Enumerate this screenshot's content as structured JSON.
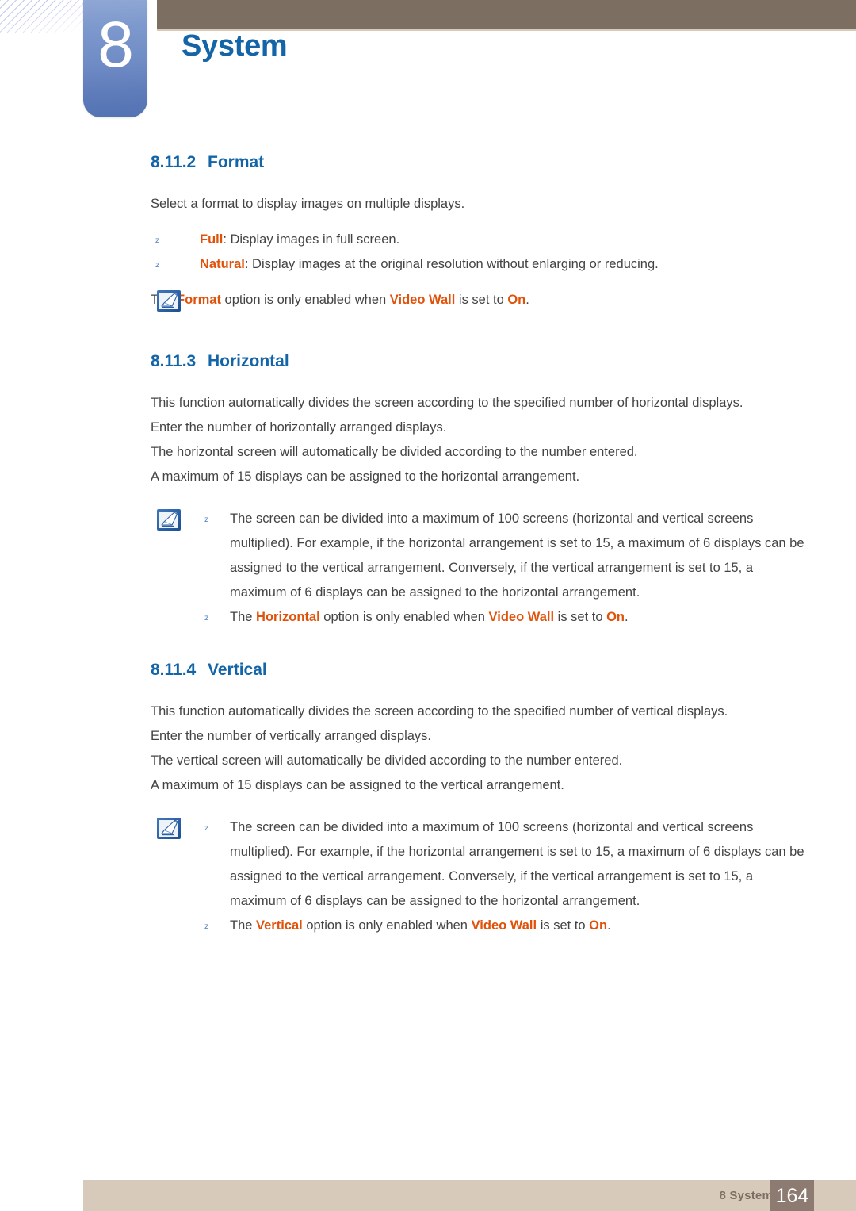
{
  "header": {
    "chapter_number": "8",
    "chapter_title": "System",
    "brand_blue": "#1365a8",
    "bar_brown": "#7d6e62",
    "badge_blue": "#6e8bc5"
  },
  "accent": {
    "highlight_orange": "#e0520a",
    "heading_blue": "#1365a8",
    "body_gray": "#434343"
  },
  "sections": [
    {
      "number": "8.11.2",
      "name": "Format",
      "intro": "Select a format to display images on multiple displays.",
      "bullets": [
        {
          "marker": "z",
          "term": "Full",
          "rest": ": Display images in full screen."
        },
        {
          "marker": "z",
          "term": "Natural",
          "rest": ": Display images at the original resolution without enlarging or reducing."
        }
      ],
      "note": {
        "icon": "note-quill-icon",
        "text_pre": "The ",
        "term1": "Format",
        "text_mid1": " option is only enabled when ",
        "term2": "Video Wall",
        "text_mid2": " is set to ",
        "term3": "On",
        "text_end": "."
      }
    },
    {
      "number": "8.11.3",
      "name": "Horizontal",
      "paragraphs": [
        "This function automatically divides the screen according to the specified number of horizontal displays.",
        "Enter the number of horizontally arranged displays.",
        "The horizontal screen will automatically be divided according to the number entered.",
        "A maximum of 15 displays can be assigned to the horizontal arrangement."
      ],
      "note": {
        "icon": "note-quill-icon",
        "item1_marker": "z",
        "item1": "The screen can be divided into a maximum of 100 screens (horizontal and vertical screens multiplied). For example, if the horizontal arrangement is set to 15, a maximum of 6 displays can be assigned to the vertical arrangement. Conversely, if the vertical arrangement is set to 15, a maximum of 6 displays can be assigned to the horizontal arrangement.",
        "item2_marker": "z",
        "item2_pre": "The ",
        "item2_term1": "Horizontal",
        "item2_mid1": " option is only enabled when ",
        "item2_term2": "Video Wall",
        "item2_mid2": " is set to ",
        "item2_term3": "On",
        "item2_end": "."
      }
    },
    {
      "number": "8.11.4",
      "name": "Vertical",
      "paragraphs": [
        "This function automatically divides the screen according to the specified number of vertical displays.",
        "Enter the number of vertically arranged displays.",
        "The vertical screen will automatically be divided according to the number entered.",
        "A maximum of 15 displays can be assigned to the vertical arrangement."
      ],
      "note": {
        "icon": "note-quill-icon",
        "item1_marker": "z",
        "item1": "The screen can be divided into a maximum of 100 screens (horizontal and vertical screens multiplied). For example, if the horizontal arrangement is set to 15, a maximum of 6 displays can be assigned to the vertical arrangement. Conversely, if the vertical arrangement is set to 15, a maximum of 6 displays can be assigned to the horizontal arrangement.",
        "item2_marker": "z",
        "item2_pre": "The ",
        "item2_term1": "Vertical",
        "item2_mid1": " option is only enabled when ",
        "item2_term2": "Video Wall",
        "item2_mid2": " is set to ",
        "item2_term3": "On",
        "item2_end": "."
      }
    }
  ],
  "footer": {
    "label": "8 System",
    "page_number": "164",
    "bar_color": "#d8cabb",
    "page_box_color": "#8d7a70"
  }
}
